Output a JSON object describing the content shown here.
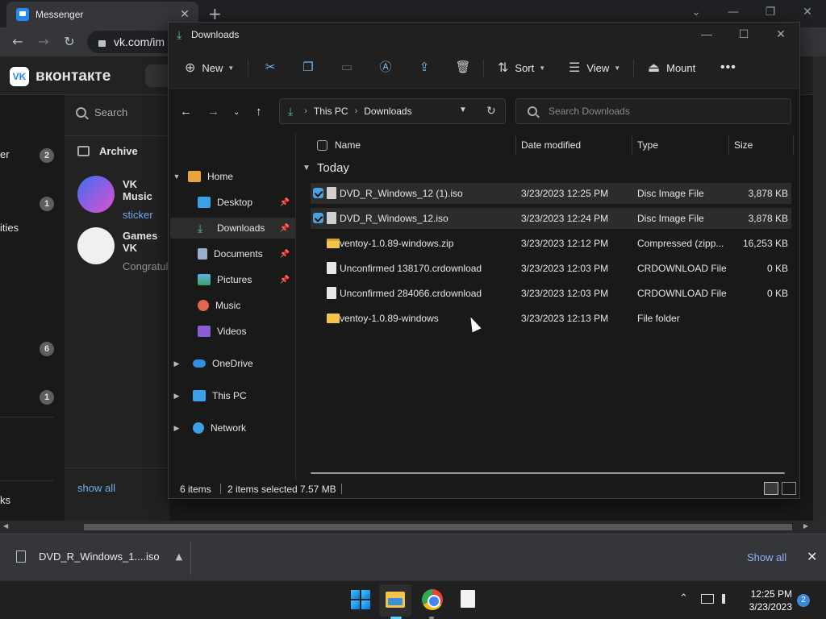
{
  "browser": {
    "tab_title": "Messenger",
    "tab_close": "✕",
    "new_tab": "+",
    "url": "vk.com/im",
    "vk_logo_text": "вконтакте",
    "left_labels": [
      "er",
      "ities",
      "ks"
    ],
    "badges": [
      "2",
      "1",
      "6",
      "1"
    ],
    "panel": {
      "search_label": "Search",
      "archive_label": "Archive",
      "chats": [
        {
          "name": "VK Music",
          "message": "sticker"
        },
        {
          "name": "Games VK",
          "message": "Congratul"
        }
      ],
      "show_all": "show all"
    }
  },
  "download_bar": {
    "file_name": "DVD_R_Windows_1....iso",
    "show_all": "Show all"
  },
  "explorer": {
    "title": "Downloads",
    "toolbar": {
      "new_label": "New",
      "sort_label": "Sort",
      "view_label": "View",
      "mount_label": "Mount"
    },
    "address": {
      "root": "This PC",
      "current": "Downloads",
      "search_placeholder": "Search Downloads"
    },
    "nav": {
      "home": "Home",
      "desktop": "Desktop",
      "downloads": "Downloads",
      "documents": "Documents",
      "pictures": "Pictures",
      "music": "Music",
      "videos": "Videos",
      "onedrive": "OneDrive",
      "thispc": "This PC",
      "network": "Network"
    },
    "columns": {
      "name": "Name",
      "date": "Date modified",
      "type": "Type",
      "size": "Size"
    },
    "group": "Today",
    "files": [
      {
        "name": "DVD_R_Windows_12 (1).iso",
        "date": "3/23/2023 12:25 PM",
        "type": "Disc Image File",
        "size": "3,878 KB"
      },
      {
        "name": "DVD_R_Windows_12.iso",
        "date": "3/23/2023 12:24 PM",
        "type": "Disc Image File",
        "size": "3,878 KB"
      },
      {
        "name": "ventoy-1.0.89-windows.zip",
        "date": "3/23/2023 12:12 PM",
        "type": "Compressed (zipp...",
        "size": "16,253 KB"
      },
      {
        "name": "Unconfirmed 138170.crdownload",
        "date": "3/23/2023 12:03 PM",
        "type": "CRDOWNLOAD File",
        "size": "0 KB"
      },
      {
        "name": "Unconfirmed 284066.crdownload",
        "date": "3/23/2023 12:03 PM",
        "type": "CRDOWNLOAD File",
        "size": "0 KB"
      },
      {
        "name": "ventoy-1.0.89-windows",
        "date": "3/23/2023 12:13 PM",
        "type": "File folder",
        "size": ""
      }
    ],
    "status": {
      "items": "6 items",
      "selected": "2 items selected",
      "size": "7.57 MB"
    }
  },
  "taskbar": {
    "time": "12:25 PM",
    "date": "3/23/2023",
    "notifications": "2"
  },
  "colors": {
    "accent": "#4ca0e0",
    "download_green": "#4fc3a1",
    "vk_blue": "#2787f5"
  }
}
